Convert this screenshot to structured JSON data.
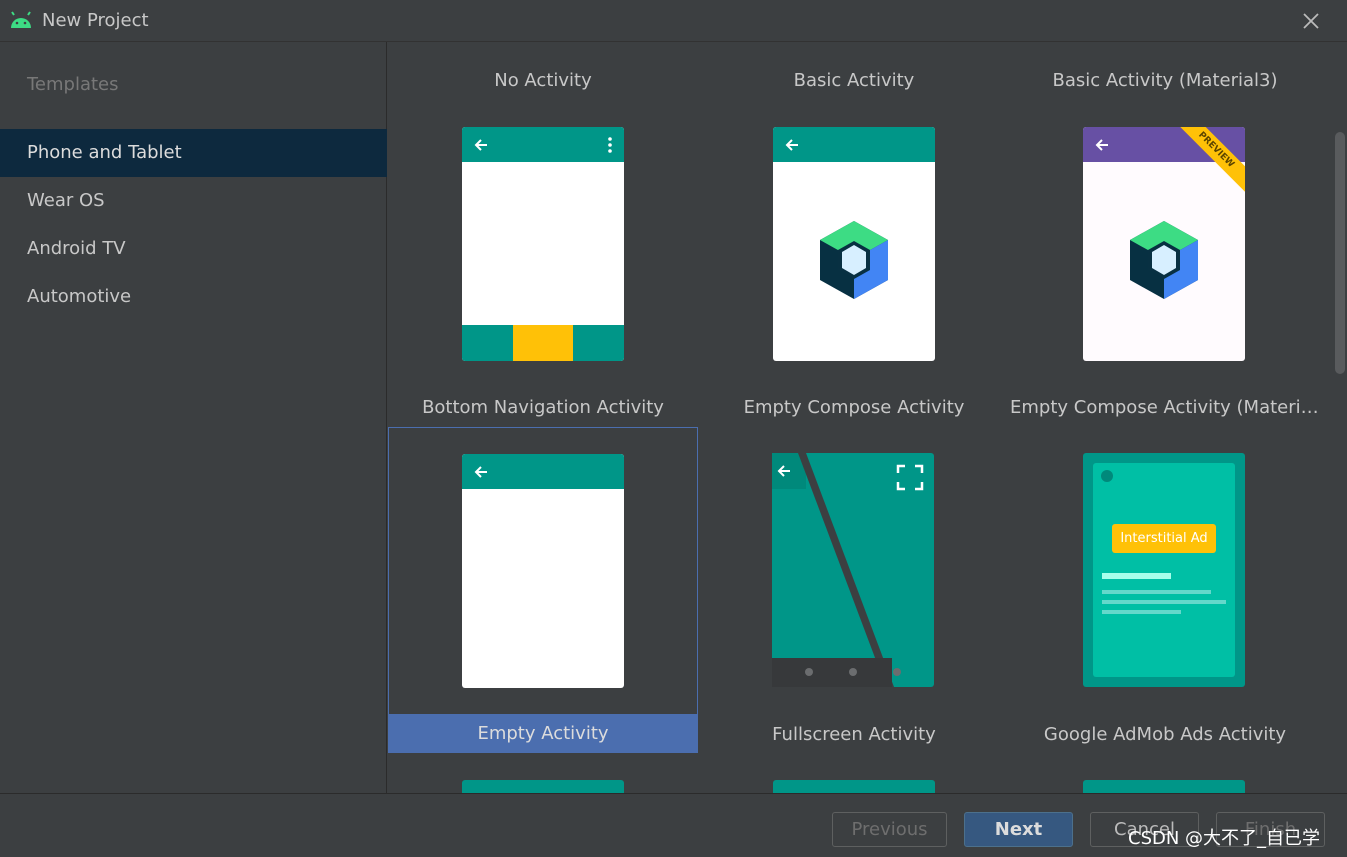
{
  "window": {
    "title": "New Project"
  },
  "sidebar": {
    "header": "Templates",
    "items": [
      {
        "label": "Phone and Tablet",
        "selected": true
      },
      {
        "label": "Wear OS"
      },
      {
        "label": "Android TV"
      },
      {
        "label": "Automotive"
      }
    ]
  },
  "templates": [
    {
      "label": "No Activity"
    },
    {
      "label": "Basic Activity"
    },
    {
      "label": "Basic Activity (Material3)"
    },
    {
      "label": "Bottom Navigation Activity"
    },
    {
      "label": "Empty Compose Activity"
    },
    {
      "label": "Empty Compose Activity (Material..."
    },
    {
      "label": "Empty Activity",
      "selected": true
    },
    {
      "label": "Fullscreen Activity"
    },
    {
      "label": "Google AdMob Ads Activity"
    }
  ],
  "badges": {
    "preview": "PREVIEW",
    "interstitial": "Interstitial Ad"
  },
  "footer": {
    "previous": "Previous",
    "next": "Next",
    "cancel": "Cancel",
    "finish": "Finish"
  },
  "watermark": "CSDN @大不了_自已学",
  "colors": {
    "teal": "#009688",
    "selection": "#4b6eaf",
    "sidebar_selected": "#0d293e",
    "amber": "#ffc107",
    "purple": "#6750a4"
  }
}
